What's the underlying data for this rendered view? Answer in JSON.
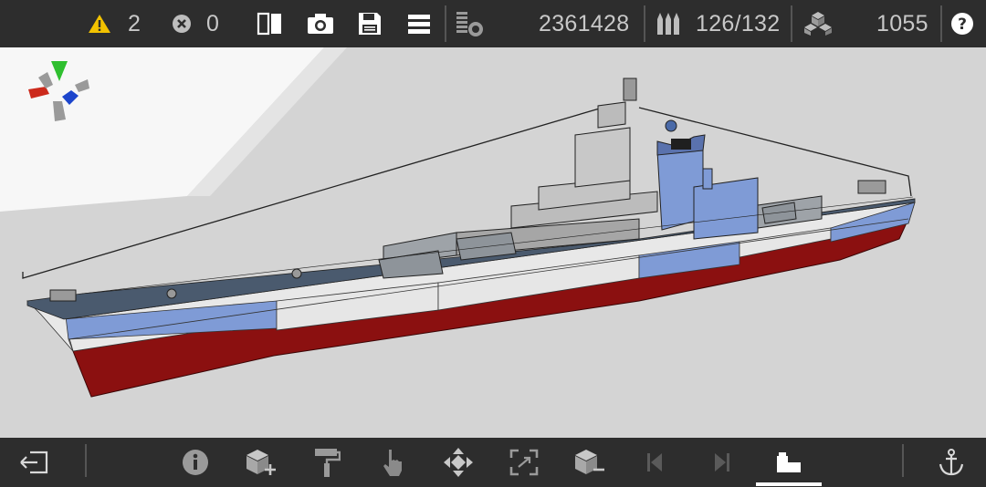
{
  "status": {
    "warnings_count": "2",
    "errors_count": "0",
    "cost_value": "2361428",
    "ammo_value": "126/132",
    "blocks_value": "1055"
  },
  "colors": {
    "bar_bg": "#2d2d2d",
    "viewport_bg": "#d4d4d4",
    "warning": "#f2c200",
    "hull_red": "#8b1010",
    "hull_blue": "#7f9bd6",
    "deck": "#4a5a6e",
    "gizmo_up": "#2fbf2f",
    "gizmo_right": "#cc2a1c",
    "gizmo_fwd": "#1c45cc"
  },
  "icons": {
    "top": [
      "warning-icon",
      "error-icon",
      "mirror-icon",
      "camera-icon",
      "save-icon",
      "menu-icon",
      "cost-icon",
      "ammo-icon",
      "blocks-icon",
      "help-icon"
    ],
    "bottom": [
      "exit-icon",
      "info-icon",
      "add-block-icon",
      "paint-roller-icon",
      "hand-pointer-icon",
      "move-icon",
      "resize-icon",
      "remove-block-icon",
      "step-back-icon",
      "step-forward-icon",
      "build-mode-icon",
      "anchor-icon"
    ]
  }
}
